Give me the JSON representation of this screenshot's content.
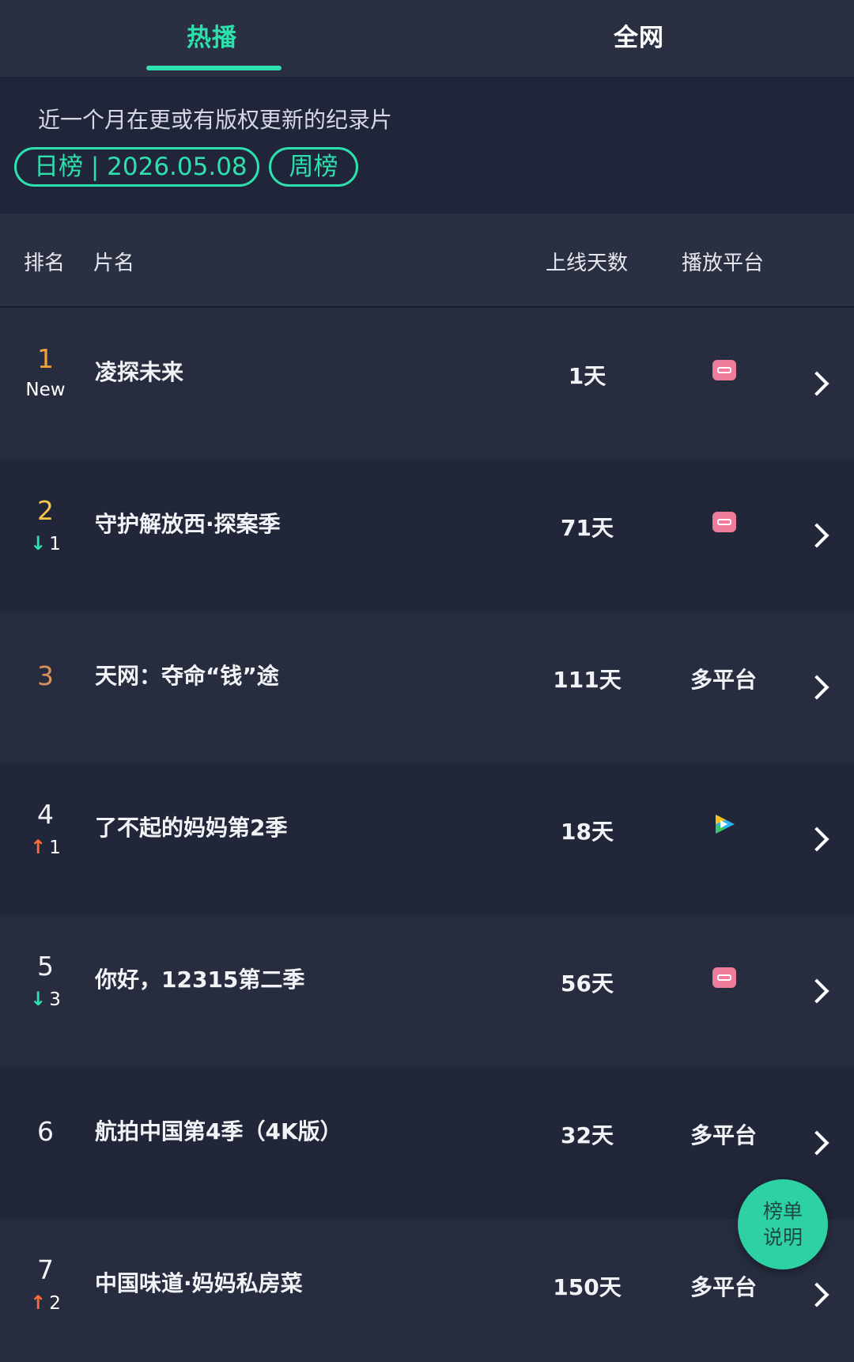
{
  "tabs": [
    {
      "label": "热播",
      "active": true
    },
    {
      "label": "全网",
      "active": false
    }
  ],
  "header": {
    "subtitle": "近一个月在更或有版权更新的纪录片",
    "daily_label": "日榜 | 2026.05.08",
    "weekly_label": "周榜"
  },
  "columns": {
    "rank": "排名",
    "title": "片名",
    "days": "上线天数",
    "platform": "播放平台"
  },
  "rows": [
    {
      "rank": "1",
      "change_text": "New",
      "title": "凌探未来",
      "days": "1天",
      "platform": "",
      "platform_icon": "bilibili-icon"
    },
    {
      "rank": "2",
      "change_dir": "down",
      "change": "1",
      "title": "守护解放西·探案季",
      "days": "71天",
      "platform": "",
      "platform_icon": "bilibili-icon"
    },
    {
      "rank": "3",
      "title": "天网：夺命“钱”途",
      "days": "111天",
      "platform": "多平台"
    },
    {
      "rank": "4",
      "change_dir": "up",
      "change": "1",
      "title": "了不起的妈妈第2季",
      "days": "18天",
      "platform": "",
      "platform_icon": "tencent-video-icon"
    },
    {
      "rank": "5",
      "change_dir": "down",
      "change": "3",
      "title": "你好，12315第二季",
      "days": "56天",
      "platform": "",
      "platform_icon": "bilibili-icon"
    },
    {
      "rank": "6",
      "title": "航拍中国第4季（4K版）",
      "days": "32天",
      "platform": "多平台"
    },
    {
      "rank": "7",
      "change_dir": "up",
      "change": "2",
      "title": "中国味道·妈妈私房菜",
      "days": "150天",
      "platform": "多平台"
    }
  ],
  "fab": {
    "line1": "榜单",
    "line2": "说明"
  },
  "arrows": {
    "up": "↑",
    "down": "↓"
  },
  "colors": {
    "accent": "#2ee0ac",
    "down": "#2ee0ac",
    "up": "#ff6a3d",
    "rank1": "#f2a13a",
    "rank2": "#f4c34a",
    "rank3": "#d8925c"
  }
}
